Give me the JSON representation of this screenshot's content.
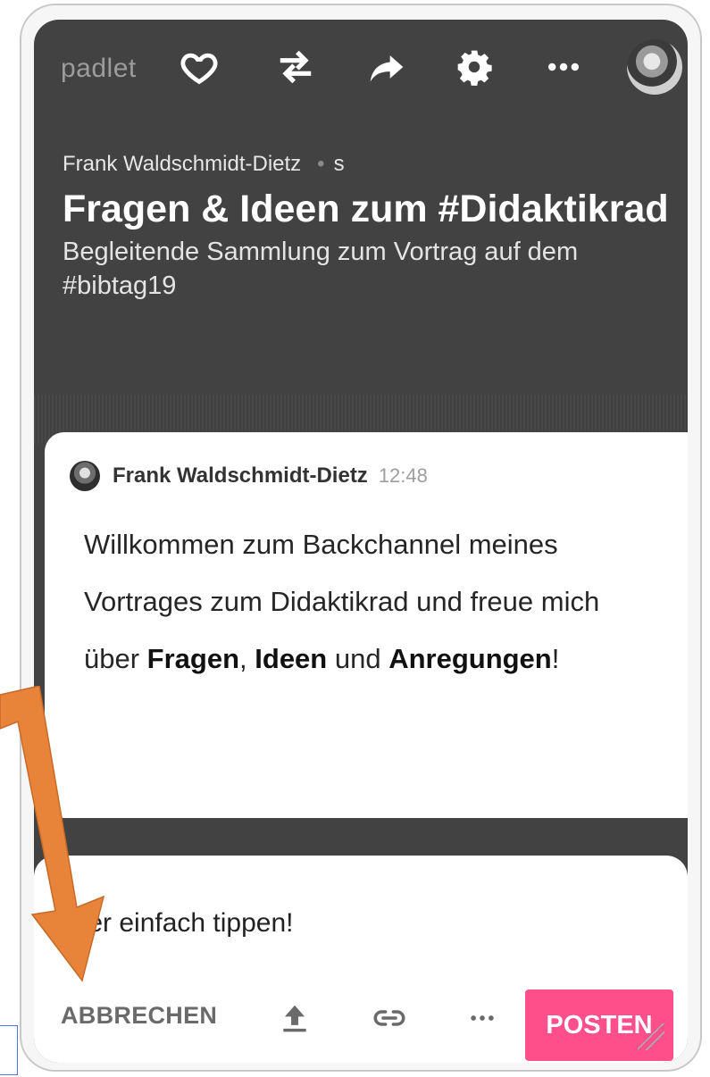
{
  "app": {
    "brand": "padlet"
  },
  "toolbar": {
    "icons": [
      "heart-icon",
      "remix-icon",
      "share-icon",
      "gear-icon",
      "more-icon",
      "avatar"
    ]
  },
  "board": {
    "author": "Frank Waldschmidt-Dietz",
    "suffix": "s",
    "title": "Fragen & Ideen zum #Didaktikrad",
    "subtitle": "Begleitende Sammlung zum Vortrag auf dem #bibtag19"
  },
  "post": {
    "author": "Frank Waldschmidt-Dietz",
    "time": "12:48",
    "text_part1": "Willkommen zum Backchannel meines Vortrages zum Didaktikrad und freue mich über ",
    "bold1": "Fragen",
    "sep1": ", ",
    "bold2": "Ideen",
    "sep2": " und ",
    "bold3": "Anregungen",
    "end": "!"
  },
  "composer": {
    "placeholder": "Hier einfach tippen!",
    "cancel_label": "ABBRECHEN",
    "post_label": "POSTEN",
    "accent_color": "#ff4f8b"
  },
  "annotation": {
    "arrow_color": "#e8833a"
  }
}
